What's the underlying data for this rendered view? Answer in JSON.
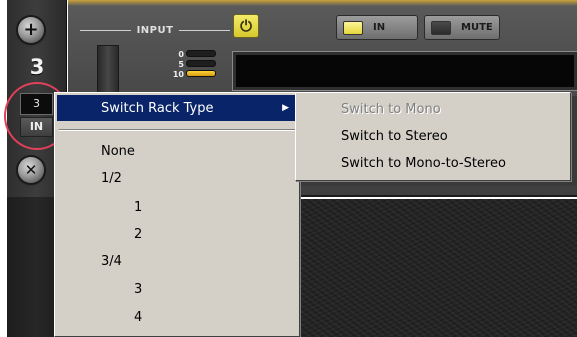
{
  "rack": {
    "number": "3",
    "type_value": "3",
    "input_state": "IN",
    "add_icon": "plus-icon",
    "remove_icon": "x-icon"
  },
  "device": {
    "input_label": "INPUT",
    "power_icon": "power-icon",
    "in_button_label": "IN",
    "mute_button_label": "MUTE",
    "meter_scale": [
      "0",
      "5",
      "10"
    ]
  },
  "context_menu": {
    "switch_rack_type": "Switch Rack Type",
    "items": [
      "None",
      "1/2",
      "1",
      "2",
      "3/4",
      "3",
      "4"
    ]
  },
  "submenu": {
    "items": [
      {
        "label": "Switch to Mono",
        "disabled": true
      },
      {
        "label": "Switch to Stereo",
        "disabled": false
      },
      {
        "label": "Switch to Mono-to-Stereo",
        "disabled": false
      }
    ]
  },
  "colors": {
    "menu_bg": "#d4d0c8",
    "menu_highlight": "#0a246a",
    "annotation_circle": "#e0405a",
    "power_yellow": "#e3d63a"
  }
}
